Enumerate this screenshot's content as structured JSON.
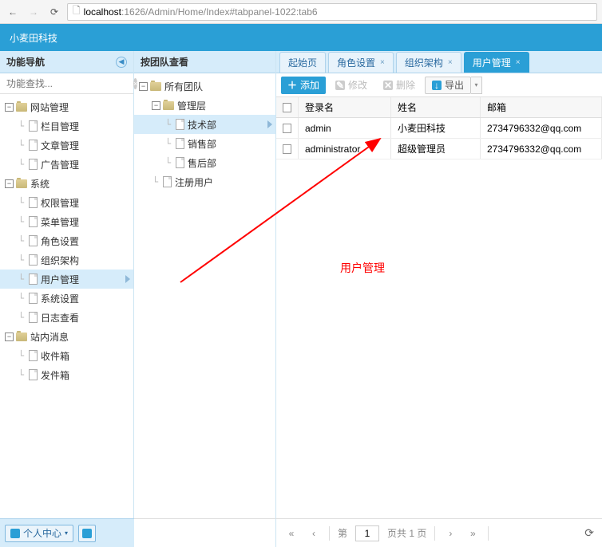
{
  "browser": {
    "url_host": "localhost",
    "url_path": ":1626/Admin/Home/Index#tabpanel-1022:tab6"
  },
  "app_title": "小麦田科技",
  "sidebar": {
    "title": "功能导航",
    "search_placeholder": "功能查找...",
    "nodes": [
      {
        "label": "网站管理",
        "type": "folder",
        "level": 0,
        "open": true
      },
      {
        "label": "栏目管理",
        "type": "file",
        "level": 1
      },
      {
        "label": "文章管理",
        "type": "file",
        "level": 1
      },
      {
        "label": "广告管理",
        "type": "file",
        "level": 1
      },
      {
        "label": "系统",
        "type": "folder",
        "level": 0,
        "open": true
      },
      {
        "label": "权限管理",
        "type": "file",
        "level": 1
      },
      {
        "label": "菜单管理",
        "type": "file",
        "level": 1
      },
      {
        "label": "角色设置",
        "type": "file",
        "level": 1
      },
      {
        "label": "组织架构",
        "type": "file",
        "level": 1
      },
      {
        "label": "用户管理",
        "type": "file",
        "level": 1,
        "selected": true
      },
      {
        "label": "系统设置",
        "type": "file",
        "level": 1
      },
      {
        "label": "日志查看",
        "type": "file",
        "level": 1
      },
      {
        "label": "站内消息",
        "type": "folder",
        "level": 0,
        "open": true
      },
      {
        "label": "收件箱",
        "type": "file",
        "level": 1
      },
      {
        "label": "发件箱",
        "type": "file",
        "level": 1
      }
    ]
  },
  "mid": {
    "title": "按团队查看",
    "nodes": [
      {
        "label": "所有团队",
        "type": "folder",
        "level": 0,
        "open": true
      },
      {
        "label": "管理层",
        "type": "folder",
        "level": 1,
        "open": true
      },
      {
        "label": "技术部",
        "type": "file",
        "level": 2,
        "selected": true
      },
      {
        "label": "销售部",
        "type": "file",
        "level": 2
      },
      {
        "label": "售后部",
        "type": "file",
        "level": 2
      },
      {
        "label": "注册用户",
        "type": "file",
        "level": 1
      }
    ]
  },
  "tabs": [
    {
      "label": "起始页",
      "closable": false,
      "active": false
    },
    {
      "label": "角色设置",
      "closable": true,
      "active": false
    },
    {
      "label": "组织架构",
      "closable": true,
      "active": false
    },
    {
      "label": "用户管理",
      "closable": true,
      "active": true
    }
  ],
  "toolbar": {
    "add": "添加",
    "edit": "修改",
    "delete": "删除",
    "export": "导出"
  },
  "table": {
    "columns": {
      "login": "登录名",
      "name": "姓名",
      "email": "邮箱"
    },
    "rows": [
      {
        "login": "admin",
        "name": "小麦田科技",
        "email": "2734796332@qq.com"
      },
      {
        "login": "administrator",
        "name": "超级管理员",
        "email": "2734796332@qq.com"
      }
    ]
  },
  "annotation": "用户管理",
  "footer_left": {
    "profile": "个人中心"
  },
  "pager": {
    "prefix": "第",
    "page": "1",
    "suffix": "页共 1 页"
  }
}
